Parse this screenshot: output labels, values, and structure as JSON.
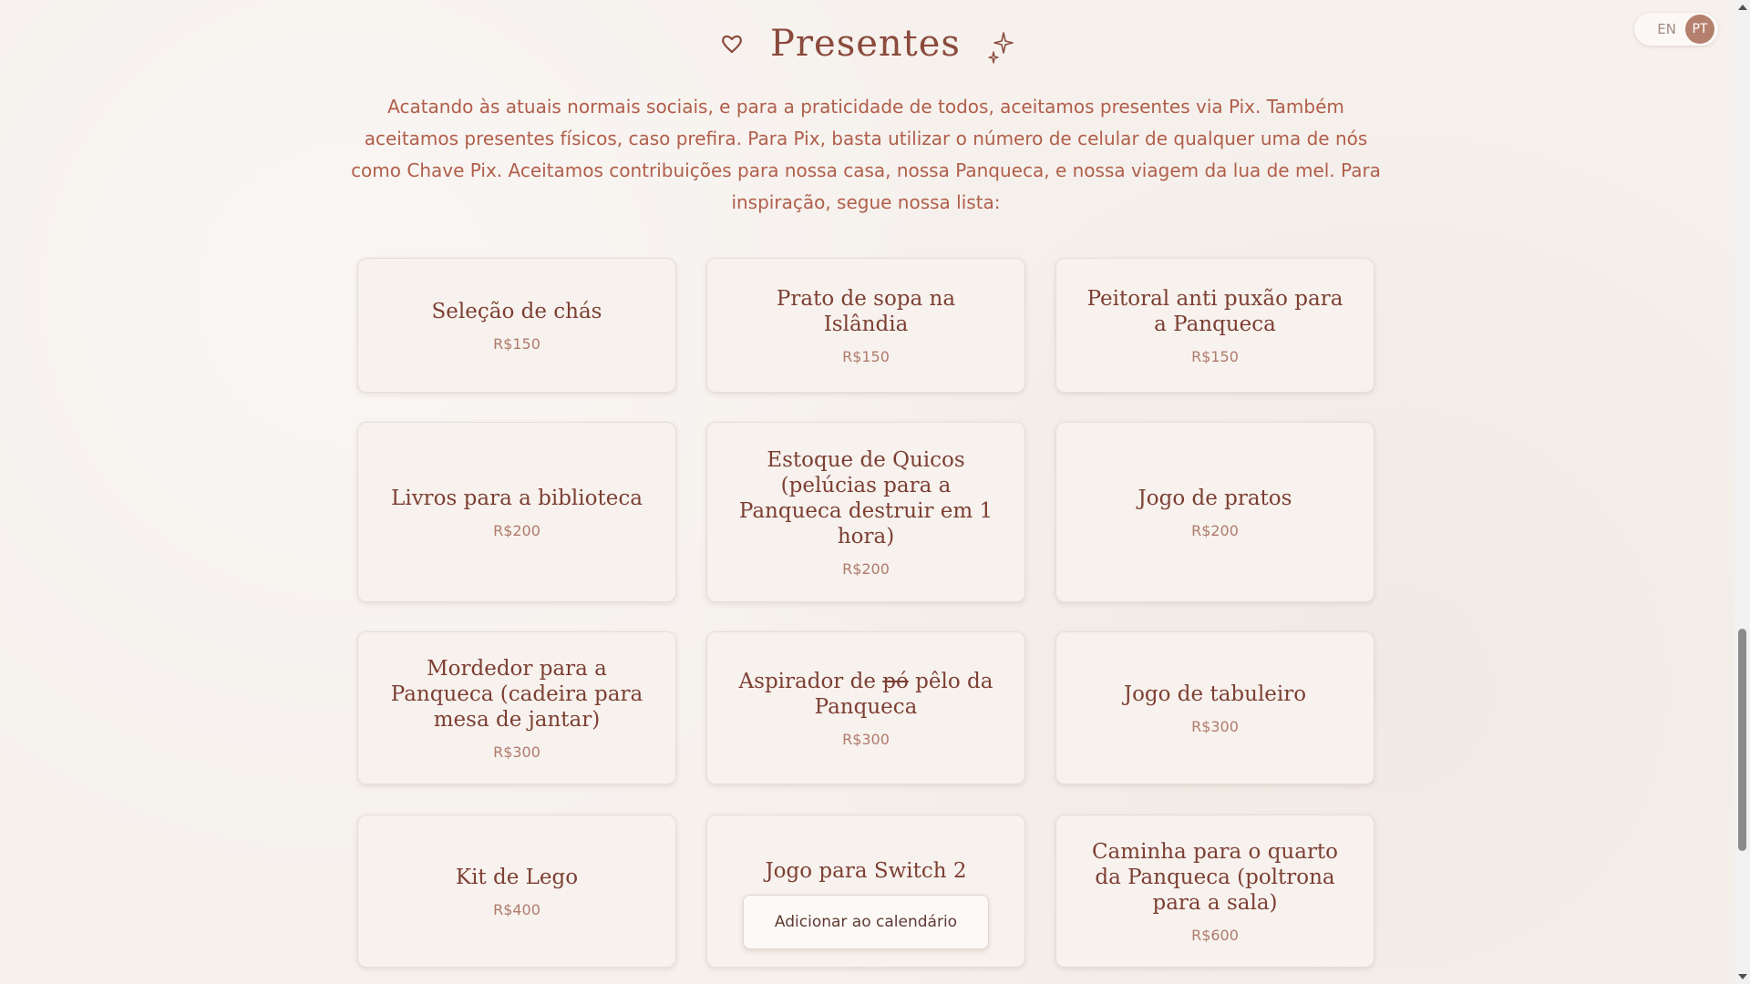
{
  "section": {
    "title": "Presentes",
    "intro": "Acatando às atuais normais sociais, e para a praticidade de todos, aceitamos presentes via Pix. Também aceitamos presentes físicos, caso prefira. Para Pix, basta utilizar o número de celular de qualquer uma de nós como Chave Pix. Aceitamos contribuições para nossa casa, nossa Panqueca, e nossa viagem da lua de mel. Para inspiração, segue nossa lista:"
  },
  "language": {
    "en": "EN",
    "pt": "PT",
    "selected": "PT"
  },
  "gifts": [
    {
      "name": "Seleção de chás",
      "price": "R$150"
    },
    {
      "name": "Prato de sopa na Islândia",
      "price": "R$150"
    },
    {
      "name": "Peitoral anti puxão para a Panqueca",
      "price": "R$150"
    },
    {
      "name": "Livros para a biblioteca",
      "price": "R$200"
    },
    {
      "name": "Estoque de Quicos (pelúcias para a Panqueca destruir em 1 hora)",
      "price": "R$200"
    },
    {
      "name": "Jogo de pratos",
      "price": "R$200"
    },
    {
      "name": "Mordedor para a Panqueca (cadeira para mesa de jantar)",
      "price": "R$300"
    },
    {
      "name_prefix": "Aspirador de",
      "name_struck": "pó",
      "name_suffix": "pêlo da Panqueca",
      "price": "R$300"
    },
    {
      "name": "Jogo de tabuleiro",
      "price": "R$300"
    },
    {
      "name": "Kit de Lego",
      "price": "R$400"
    },
    {
      "name": "Jogo para Switch 2",
      "button": "Adicionar ao calendário"
    },
    {
      "name": "Caminha para o quarto da Panqueca (poltrona para a sala)",
      "price": "R$600"
    }
  ],
  "icons": {
    "title_left": "heart-icon",
    "title_right": "sparkle-icon"
  },
  "colors": {
    "background": "#f6f1ed",
    "title": "#8a4a3c",
    "text": "#b05e4a",
    "accent": "#b47f6c"
  }
}
